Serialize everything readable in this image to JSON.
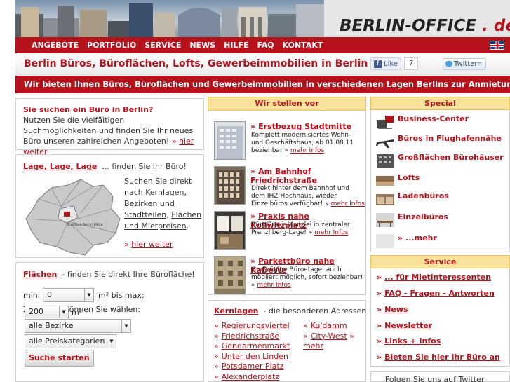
{
  "header": {
    "logo_main": "BERLIN-OFFICE",
    "logo_tld": ". de"
  },
  "nav": {
    "items": [
      "ANGEBOTE",
      "PORTFOLIO",
      "SERVICE",
      "NEWS",
      "HILFE",
      "FAQ",
      "KONTAKT"
    ]
  },
  "titlebar": {
    "title": "Berlin Büros, Büroflächen, Lofts, Gewerbeimmobilien in Berlin",
    "like_label": "Like",
    "like_count": "7",
    "twitter_label": "Twittern"
  },
  "strip": {
    "text": "Wir bieten Ihnen Büros, Büroflächen und Gewerbeimmobilien in verschiedenen Lagen Berlins zur Anmietung an!"
  },
  "search_intro": {
    "heading": "Sie suchen ein Büro in Berlin?",
    "text": "Nutzen Sie die vielfältigen Suchmöglichkeiten und finden Sie Ihr neues Büro unseren zahlreichen Angeboten!",
    "link_prefix": "»",
    "link": "hier weiter"
  },
  "lage": {
    "heading": "Lage, Lage, Lage",
    "subheading": "... finden Sie Ihr Büro!",
    "text_1": "Suchen Sie direkt nach ",
    "link_kernlagen": "Kernlagen",
    "link_bezirke": "Bezirken und Stadtteilen",
    "link_flaechen": "Flächen",
    "link_mietpreise": "und Mietpreisen",
    "link_prefix": "»",
    "link": "hier weiter",
    "map_label": "Stadtteil Berlin Mitte"
  },
  "flaechen": {
    "heading": "Flächen",
    "subheading": "- finden Sie direkt Ihre Bürofläche!",
    "min_label": "min:",
    "min_value": "0",
    "max_label": "m² bis max:",
    "max_value": "200",
    "unit": "m²",
    "also_label": "Zusätzlich können Sie wählen:",
    "district": "alle Bezirke",
    "price": "alle Preiskategorien",
    "submit": "Suche starten"
  },
  "offers": {
    "heading": "Wir stellen vor",
    "items": [
      {
        "title": "Erstbezug Stadtmitte",
        "desc": "Komplett modernisiertes Wohn- und Geschäftshaus, ab 01.08.11 beziehbar",
        "more": "mehr Infos"
      },
      {
        "title": "Am Bahnhof Friedrichstraße",
        "desc": "Direkt hinter dem Bahnhof und dem IHZ-Hochhaus, wieder Einzelbüros verfügbar!",
        "more": "mehr Infos"
      },
      {
        "title": "Praxis nahe Kollwitzplatz",
        "desc": "Büro/Praxis/Kanzlei in zentraler Prenzl'berg-Lage!",
        "more": "mehr Infos"
      },
      {
        "title": "Parkettbüro nahe KaDeWe",
        "desc": "Großzügige Büroetage, auch möbliert möglich, sofort beziehbar!",
        "more": "mehr Infos"
      }
    ]
  },
  "kernlagen": {
    "heading": "Kernlagen",
    "subheading": "- die besonderen Adressen",
    "col1": [
      "Regierungsviertel",
      "Friedrichstraße",
      "Gendarmenmarkt",
      "Unter den Linden",
      "Potsdamer Platz",
      "Alexanderplatz"
    ],
    "col2": [
      "Ku'damm",
      "City-West",
      "mehr"
    ]
  },
  "special": {
    "heading": "Special",
    "items": [
      "Business-Center",
      "Büros in Flughafennähe",
      "Großflächen Bürohäuser",
      "Lofts",
      "Ladenbüros",
      "Einzelbüros",
      "...mehr"
    ]
  },
  "service": {
    "heading": "Service",
    "items": [
      "... für Mietinteressenten",
      "FAQ - Fragen - Antworten",
      "News",
      "Newsletter",
      "Links + Infos",
      "Bieten Sie hier Ihr Büro an"
    ]
  },
  "follow": {
    "text": "Folgen Sie uns auf Twitter"
  },
  "colors": {
    "brand_red": "#b5121b",
    "header_yellow": "#f9e29a"
  }
}
